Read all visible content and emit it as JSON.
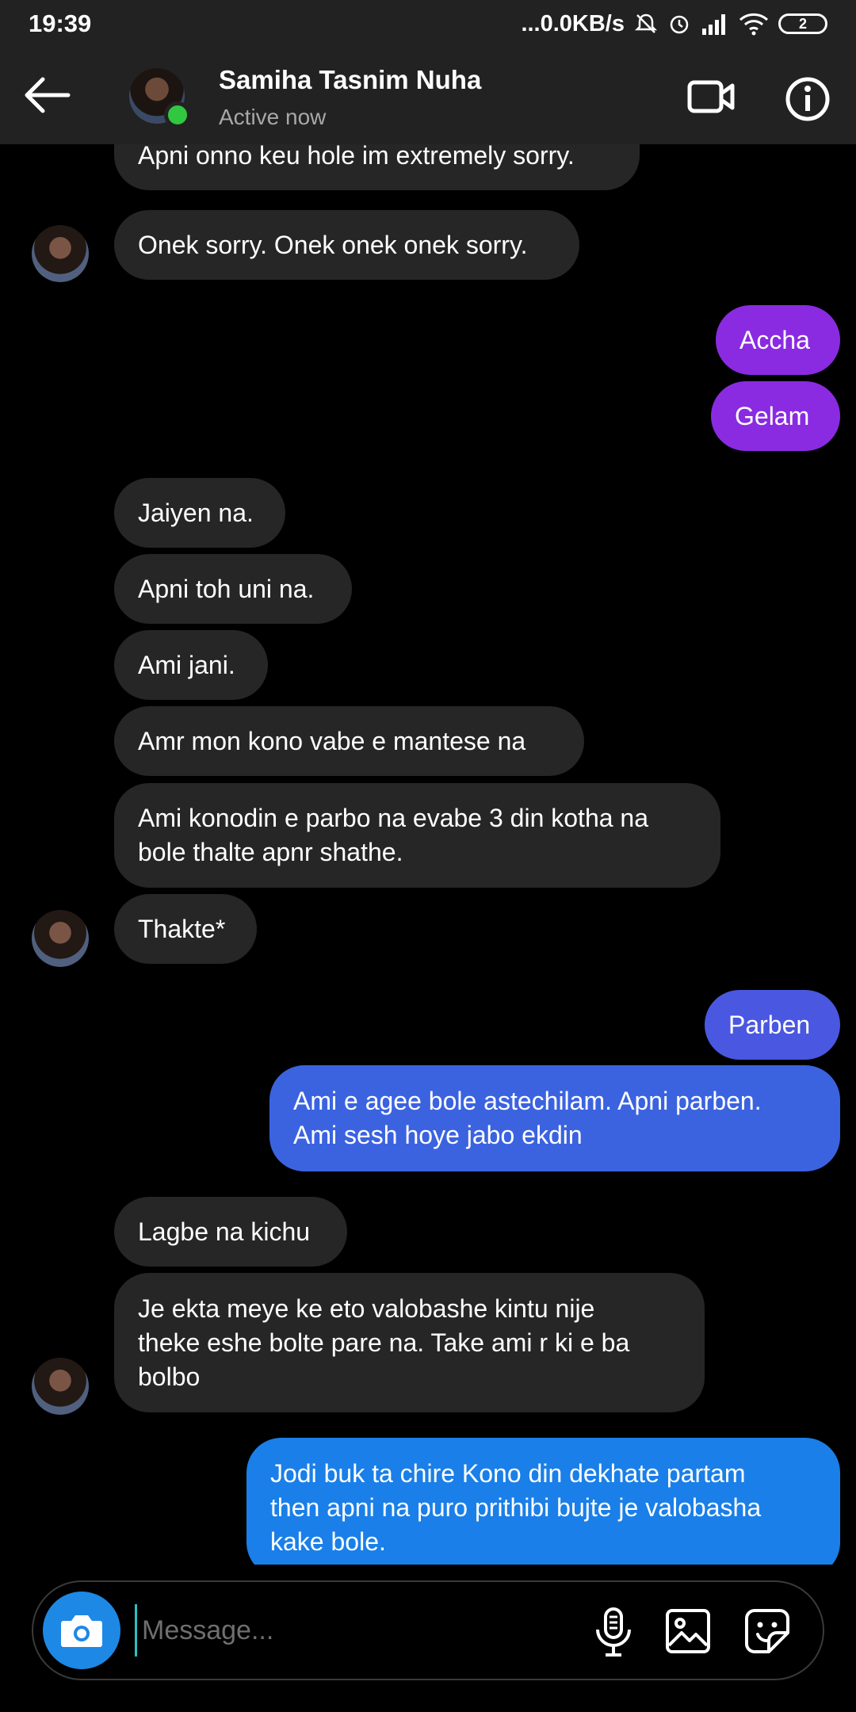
{
  "status_bar": {
    "time": "19:39",
    "network": "...0.0KB/s",
    "battery": "2"
  },
  "header": {
    "name": "Samiha Tasnim Nuha",
    "status": "Active now"
  },
  "messages": [
    {
      "text": "Apni onno keu hole im extremely sorry."
    },
    {
      "text": "Onek sorry. Onek onek onek sorry."
    },
    {
      "text": "Accha"
    },
    {
      "text": "Gelam"
    },
    {
      "text": "Jaiyen na."
    },
    {
      "text": "Apni toh uni na."
    },
    {
      "text": "Ami jani."
    },
    {
      "text": "Amr mon kono vabe e mantese na"
    },
    {
      "line1": "Ami konodin e parbo na evabe 3 din kotha na",
      "line2": "bole thalte apnr shathe."
    },
    {
      "text": "Thakte*"
    },
    {
      "text": "Parben"
    },
    {
      "line1": "Ami e agee bole astechilam. Apni parben.",
      "line2": "Ami sesh hoye jabo ekdin"
    },
    {
      "text": "Lagbe na kichu"
    },
    {
      "line1": "Je ekta meye ke eto valobashe kintu nije",
      "line2": "theke eshe bolte pare na. Take ami r ki e ba",
      "line3": "bolbo"
    },
    {
      "line1": "Jodi buk ta chire Kono din dekhate partam",
      "line2": "then apni na puro prithibi bujte je valobasha",
      "line3": "kake bole."
    }
  ],
  "composer": {
    "placeholder": "Message..."
  },
  "colors": {
    "incoming": "#262626",
    "outgoing_purple": "#8a2be2",
    "outgoing_indigo": "#4a57e0",
    "outgoing_blue": "#3b63e0",
    "outgoing_sky": "#1a7fe8",
    "camera_button": "#1e88e5",
    "online": "#31c740"
  },
  "icons": [
    "back-arrow-icon",
    "video-call-icon",
    "info-icon",
    "camera-icon",
    "microphone-icon",
    "gallery-icon",
    "sticker-icon"
  ]
}
